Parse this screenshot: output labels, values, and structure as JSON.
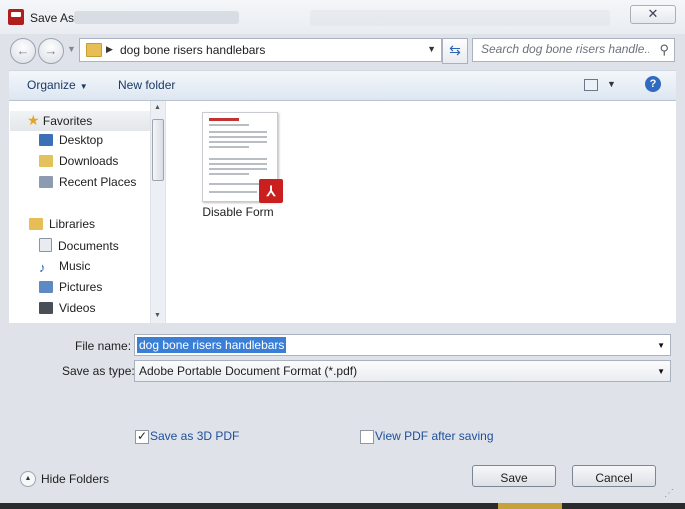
{
  "window": {
    "title": "Save As"
  },
  "address": {
    "breadcrumb": "dog bone risers handlebars"
  },
  "search": {
    "placeholder": "Search dog bone risers handle..."
  },
  "toolbar": {
    "organize_label": "Organize",
    "new_folder_label": "New folder"
  },
  "sidebar": {
    "favorites_label": "Favorites",
    "favorites": [
      {
        "label": "Desktop",
        "icon": "desktop-icon"
      },
      {
        "label": "Downloads",
        "icon": "downloads-icon"
      },
      {
        "label": "Recent Places",
        "icon": "recent-places-icon"
      }
    ],
    "libraries_label": "Libraries",
    "libraries": [
      {
        "label": "Documents",
        "icon": "documents-icon"
      },
      {
        "label": "Music",
        "icon": "music-icon"
      },
      {
        "label": "Pictures",
        "icon": "pictures-icon"
      },
      {
        "label": "Videos",
        "icon": "videos-icon"
      }
    ]
  },
  "files": [
    {
      "name": "Disable Form",
      "type": "pdf"
    }
  ],
  "form": {
    "file_name_label": "File name:",
    "file_name_value": "dog bone risers handlebars",
    "save_type_label": "Save as type:",
    "save_type_value": "Adobe Portable Document Format (*.pdf)"
  },
  "options": {
    "save_3d_label": "Save as 3D PDF",
    "save_3d_checked": true,
    "view_after_label": "View PDF after saving",
    "view_after_checked": false
  },
  "footer": {
    "hide_folders_label": "Hide Folders",
    "save_label": "Save",
    "cancel_label": "Cancel"
  },
  "colors": {
    "accent": "#3a7fd5",
    "pdf_red": "#c91f1f",
    "link_blue": "#1f4f9a"
  }
}
